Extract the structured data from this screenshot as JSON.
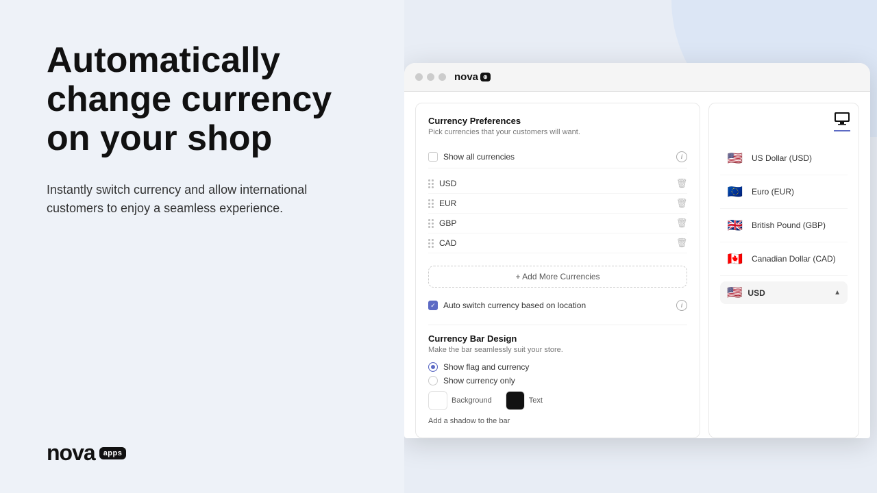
{
  "left": {
    "heading": "Automatically change currency on your shop",
    "subtext": "Instantly switch currency and allow international customers to enjoy a seamless experience.",
    "logo_text": "nova",
    "logo_badge": "apps"
  },
  "browser": {
    "logo_text": "nova",
    "logo_badge": "⊕",
    "settings": {
      "title": "Currency Preferences",
      "subtitle": "Pick currencies that your customers will want.",
      "show_all_label": "Show all currencies",
      "currencies": [
        "USD",
        "EUR",
        "GBP",
        "CAD"
      ],
      "add_more_label": "+ Add More Currencies",
      "auto_switch_label": "Auto switch currency based on location",
      "design_title": "Currency Bar Design",
      "design_subtitle": "Make the bar seamlessly suit your store.",
      "radio1": "Show flag and currency",
      "radio2": "Show currency only",
      "bg_label": "Background",
      "text_label": "Text",
      "shadow_label": "Add a shadow to the bar"
    },
    "preview": {
      "items": [
        {
          "name": "US Dollar (USD)",
          "flag": "🇺🇸"
        },
        {
          "name": "Euro (EUR)",
          "flag": "🇪🇺"
        },
        {
          "name": "British Pound (GBP)",
          "flag": "🇬🇧"
        },
        {
          "name": "Canadian Dollar (CAD)",
          "flag": "🇨🇦"
        }
      ],
      "selected_flag": "🇺🇸",
      "selected_code": "USD"
    }
  }
}
